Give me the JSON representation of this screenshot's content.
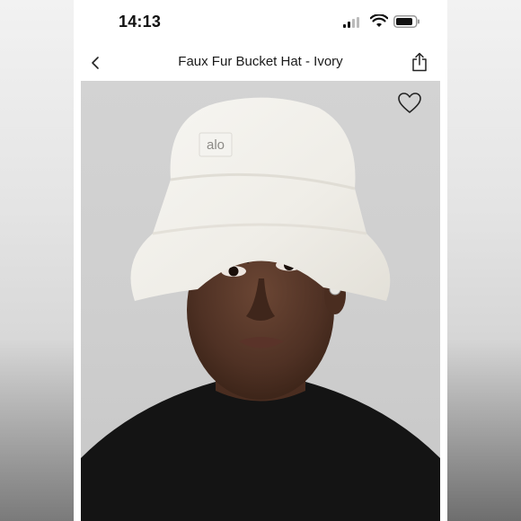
{
  "status_bar": {
    "time": "14:13",
    "icons": [
      "cellular-signal-icon",
      "wifi-icon",
      "battery-icon"
    ]
  },
  "nav": {
    "title": "Faux Fur Bucket Hat - Ivory",
    "icons": [
      "chevron-left-icon",
      "share-icon"
    ]
  },
  "product": {
    "brand_label": "alo",
    "wishlist_icon": "heart-icon"
  },
  "colors": {
    "background": "#ffffff",
    "text": "#1a1a1a",
    "photo_backdrop": "#d1d1d1",
    "hat": "#f3f1ec"
  }
}
